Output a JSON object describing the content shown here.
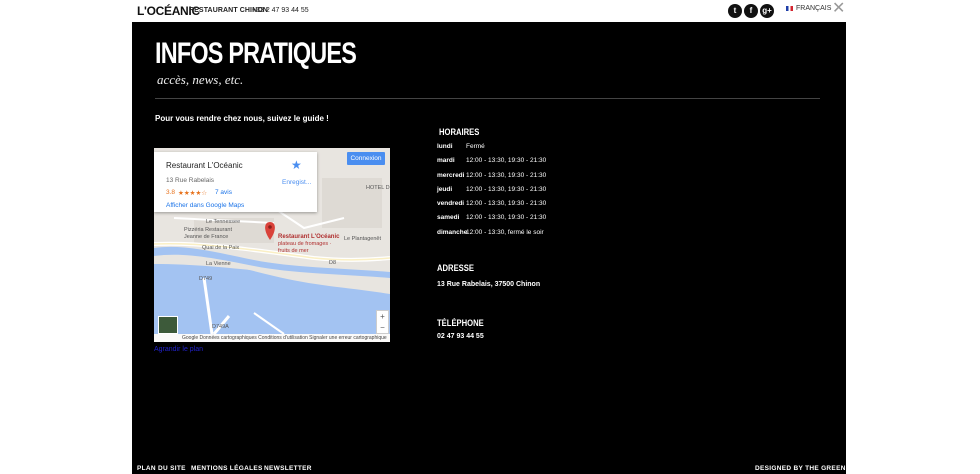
{
  "header": {
    "brand": "L'OCÉANIC",
    "subtitle": "RESTAURANT CHINON",
    "phone": "+33 2 47 93 44 55",
    "social": [
      {
        "name": "twitter-icon",
        "glyph": "t"
      },
      {
        "name": "facebook-icon",
        "glyph": "f"
      },
      {
        "name": "google-plus-icon",
        "glyph": "g+"
      }
    ],
    "language": "FRANÇAIS"
  },
  "page": {
    "title": "INFOS PRATIQUES",
    "subtitle": "accès, news, etc.",
    "guide": "Pour vous rendre chez nous, suivez le guide !"
  },
  "map": {
    "place_name": "Restaurant L'Océanic",
    "address": "13 Rue Rabelais",
    "rating": "3.8",
    "stars": "★★★★☆",
    "reviews": "7 avis",
    "open_link": "Afficher dans Google Maps",
    "save_label": "Enregist...",
    "login_label": "Connexion",
    "pin_title": "Restaurant L'Océanic",
    "pin_subtitle": "plateau de fromages · fruits de mer",
    "labels": {
      "tennessee": "Le Tennessee",
      "pizzeria": "Pizzéria Restaurant",
      "jeanne": "Jeanne de France",
      "quai": "Quai de la Paix",
      "vienne": "La Vienne",
      "plantagenet": "Le Plantagenêt",
      "hotel": "HOTEL D",
      "d8": "D8",
      "d749": "D749",
      "d749a": "D749A"
    },
    "footer": "Google   Données cartographiques   Conditions d'utilisation   Signaler une erreur cartographique",
    "zoom_plus": "+",
    "zoom_minus": "−",
    "enlarge": "Agrandir le plan"
  },
  "hours": {
    "title": "HORAIRES",
    "rows": [
      {
        "day": "lundi",
        "time": "Fermé"
      },
      {
        "day": "mardi",
        "time": "12:00 - 13:30, 19:30 - 21:30"
      },
      {
        "day": "mercredi",
        "time": "12:00 - 13:30, 19:30 - 21:30"
      },
      {
        "day": "jeudi",
        "time": "12:00 - 13:30, 19:30 - 21:30"
      },
      {
        "day": "vendredi",
        "time": "12:00 - 13:30, 19:30 - 21:30"
      },
      {
        "day": "samedi",
        "time": "12:00 - 13:30, 19:30 - 21:30"
      },
      {
        "day": "dimanche",
        "time": "12:00 - 13:30, fermé le soir"
      }
    ]
  },
  "address": {
    "title": "ADRESSE",
    "value": "13 Rue Rabelais, 37500 Chinon"
  },
  "phone": {
    "title": "TÉLÉPHONE",
    "value": "02 47 93 44 55"
  },
  "footer": {
    "plan": "PLAN DU SITE",
    "legal": "MENTIONS LÉGALES",
    "newsletter": "NEWSLETTER",
    "credit": "DESIGNED BY THE GREEN ID"
  },
  "colors": {
    "panel": "#000000",
    "river": "#a3c3f2",
    "link": "#1a73e8",
    "pin": "#d9423a"
  }
}
